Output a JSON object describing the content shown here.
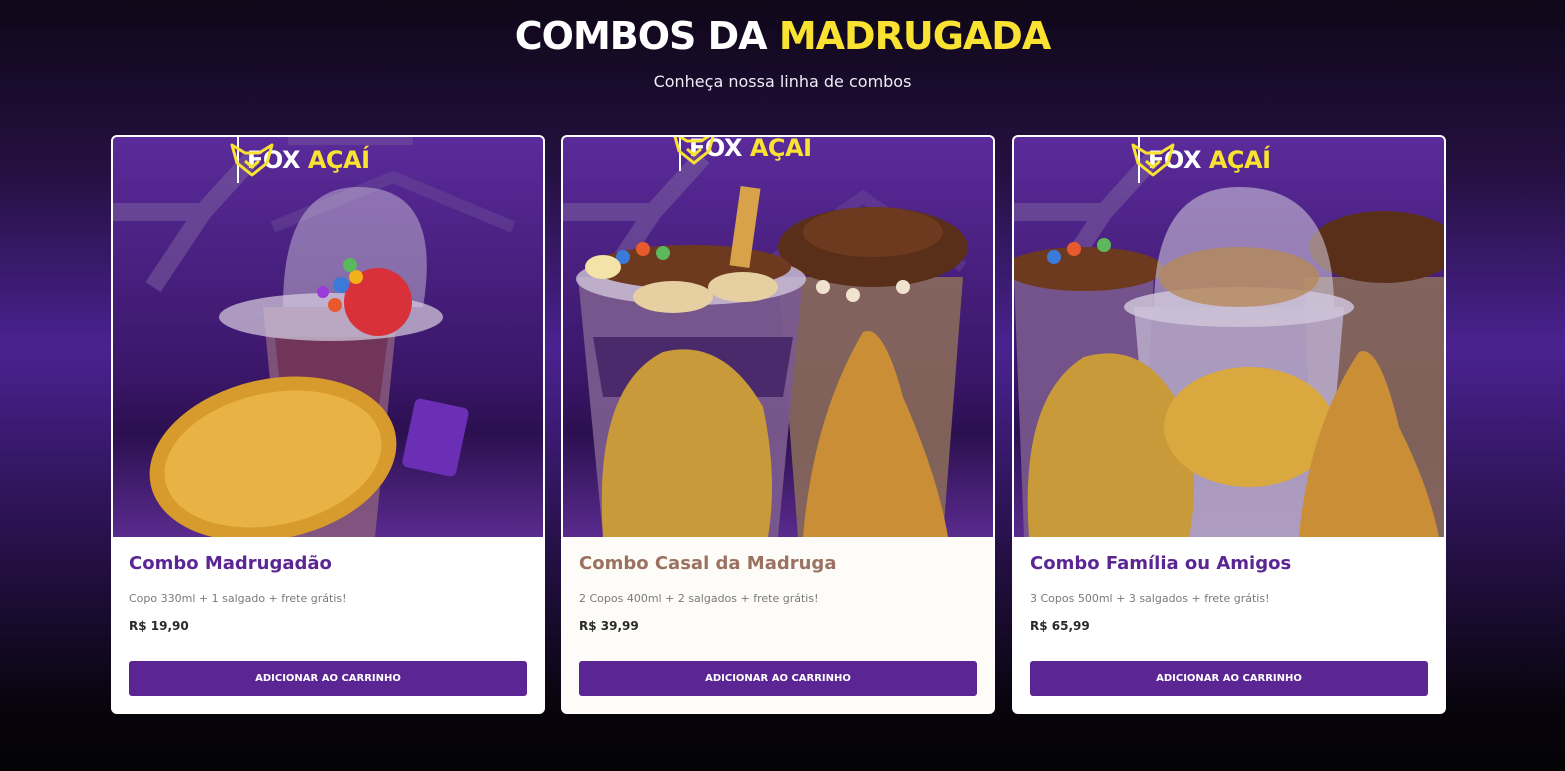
{
  "section": {
    "heading_white": "COMBOS DA",
    "heading_yellow": "MADRUGADA",
    "subtitle": "Conheça nossa linha de combos"
  },
  "brand": {
    "name_white": "FOX",
    "name_yellow": "AÇAÍ",
    "icon": "fox-head-icon"
  },
  "colors": {
    "accent_purple": "#5b2693",
    "accent_yellow": "#f9e231",
    "title_brown": "#9b7262"
  },
  "products": [
    {
      "title": "Combo Madrugadão",
      "description": "Copo 330ml + 1 salgado + frete grátis!",
      "price": "R$ 19,90",
      "button": "ADICIONAR AO CARRINHO"
    },
    {
      "title": "Combo Casal da Madruga",
      "description": "2 Copos 400ml + 2 salgados + frete grátis!",
      "price": "R$ 39,99",
      "button": "ADICIONAR AO CARRINHO"
    },
    {
      "title": "Combo Família ou Amigos",
      "description": "3 Copos 500ml + 3 salgados + frete grátis!",
      "price": "R$ 65,99",
      "button": "ADICIONAR AO CARRINHO"
    }
  ]
}
